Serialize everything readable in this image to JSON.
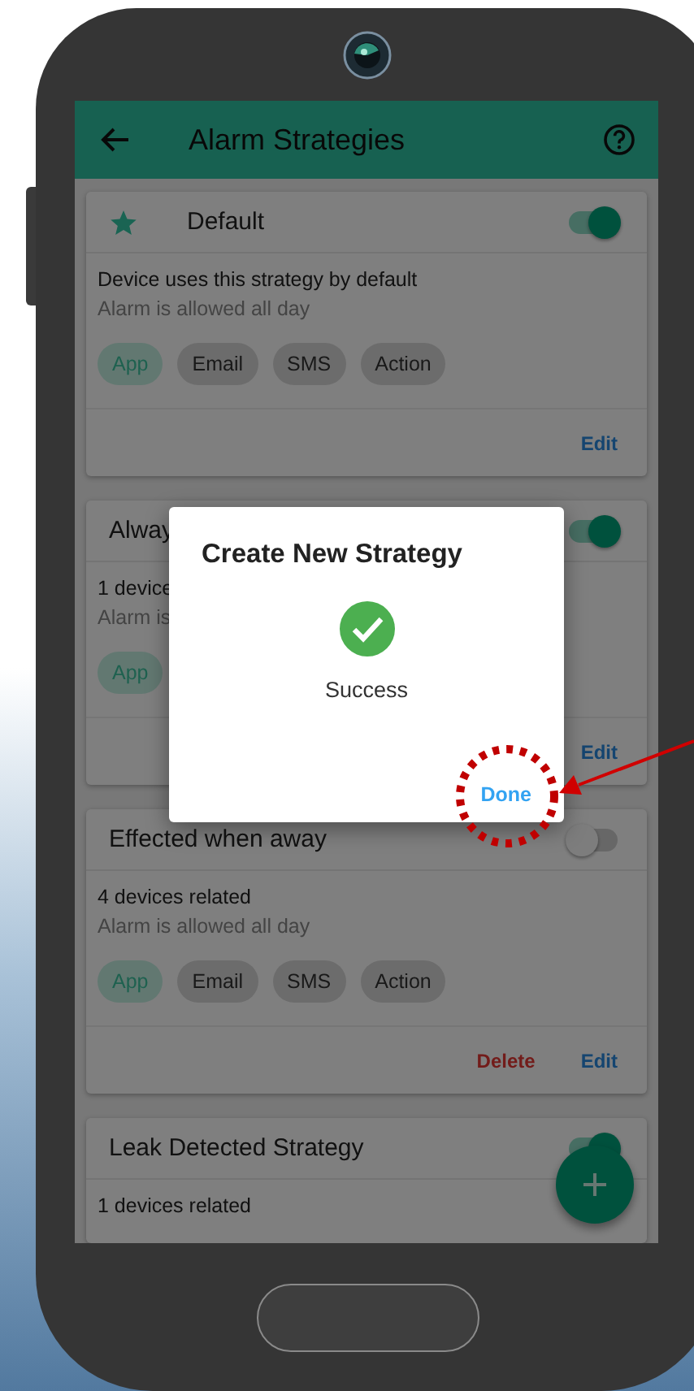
{
  "app_bar": {
    "title": "Alarm Strategies"
  },
  "strategies": [
    {
      "title": "Default",
      "starred": true,
      "enabled": true,
      "description": "Device uses this strategy by default",
      "schedule": "Alarm is allowed all day",
      "channels": [
        {
          "label": "App",
          "selected": true
        },
        {
          "label": "Email",
          "selected": false
        },
        {
          "label": "SMS",
          "selected": false
        },
        {
          "label": "Action",
          "selected": false
        }
      ],
      "actions": [
        {
          "kind": "edit",
          "label": "Edit"
        }
      ]
    },
    {
      "title": "Alway",
      "starred": false,
      "enabled": true,
      "description": "1 device",
      "schedule": "Alarm is",
      "channels": [
        {
          "label": "App",
          "selected": true
        }
      ],
      "actions": [
        {
          "kind": "edit",
          "label": "Edit"
        }
      ]
    },
    {
      "title": "Effected when away",
      "starred": false,
      "enabled": false,
      "description": "4 devices related",
      "schedule": "Alarm is allowed all day",
      "channels": [
        {
          "label": "App",
          "selected": true
        },
        {
          "label": "Email",
          "selected": false
        },
        {
          "label": "SMS",
          "selected": false
        },
        {
          "label": "Action",
          "selected": false
        }
      ],
      "actions": [
        {
          "kind": "delete",
          "label": "Delete"
        },
        {
          "kind": "edit",
          "label": "Edit"
        }
      ]
    },
    {
      "title": "Leak Detected Strategy",
      "starred": false,
      "enabled": true,
      "description": "1 devices related"
    }
  ],
  "dialog": {
    "title": "Create New Strategy",
    "message": "Success",
    "button": "Done"
  }
}
